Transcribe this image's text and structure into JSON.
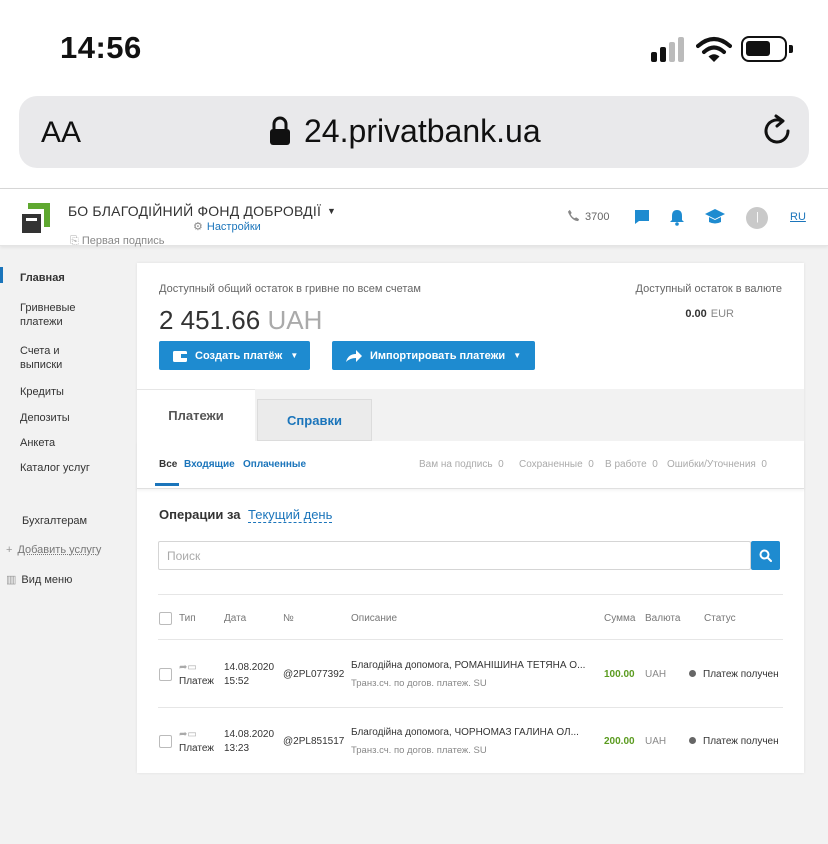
{
  "status_bar": {
    "time": "14:56"
  },
  "browser": {
    "text_size_label": "AA",
    "url": "24.privatbank.ua"
  },
  "header": {
    "org_name": "БО БЛАГОДІЙНИЙ ФОНД ДОБРОВДІЇ",
    "signature_label": "Первая подпись",
    "settings_label": "Настройки",
    "phone": "3700",
    "language": "RU",
    "avatar_letter": "|"
  },
  "sidebar": {
    "items": [
      {
        "label": "Главная",
        "active": true
      },
      {
        "label": "Гривневые платежи"
      },
      {
        "label": "Счета и выписки"
      },
      {
        "label": "Кредиты"
      },
      {
        "label": "Депозиты"
      },
      {
        "label": "Анкета"
      },
      {
        "label": "Каталог услуг"
      }
    ],
    "accountants_label": "Бухгалтерам",
    "add_service_label": "Добавить услугу",
    "view_menu_label": "Вид меню"
  },
  "balance": {
    "label": "Доступный общий остаток в гривне по всем счетам",
    "amount": "2 451.66",
    "currency": "UAH",
    "fx_label": "Доступный остаток в валюте",
    "fx_amount": "0.00",
    "fx_currency": "EUR"
  },
  "actions": {
    "create_payment": "Создать платёж",
    "import_payments": "Импортировать платежи"
  },
  "tabs": [
    {
      "label": "Платежи",
      "active": true
    },
    {
      "label": "Справки",
      "active": false
    }
  ],
  "filters": {
    "all": "Все",
    "incoming": "Входящие",
    "paid": "Оплаченные",
    "statuses": [
      {
        "label": "Вам на подпись",
        "count": "0"
      },
      {
        "label": "Сохраненные",
        "count": "0"
      },
      {
        "label": "В работе",
        "count": "0"
      },
      {
        "label": "Ошибки/Уточнения",
        "count": "0"
      }
    ]
  },
  "operations": {
    "label": "Операции за",
    "period": "Текущий день"
  },
  "search": {
    "placeholder": "Поиск"
  },
  "table": {
    "columns": [
      "Тип",
      "Дата",
      "№",
      "Описание",
      "Сумма",
      "Валюта",
      "Статус"
    ],
    "rows": [
      {
        "type": "Платеж",
        "date": "14.08.2020",
        "time": "15:52",
        "number": "@2PL077392",
        "description": "Благодійна допомога, РОМАНІШИНА ТЕТЯНА О...",
        "sub": "Транз.сч. по догов. платеж. SU",
        "amount": "100.00",
        "currency": "UAH",
        "status": "Платеж получен"
      },
      {
        "type": "Платеж",
        "date": "14.08.2020",
        "time": "13:23",
        "number": "@2PL851517",
        "description": "Благодійна допомога, ЧОРНОМАЗ ГАЛИНА ОЛ...",
        "sub": "Транз.сч. по догов. платеж. SU",
        "amount": "200.00",
        "currency": "UAH",
        "status": "Платеж получен"
      }
    ]
  },
  "colors": {
    "accent": "#1e8bd0",
    "link": "#1b75bb",
    "logo_green": "#5fa830",
    "amount_green": "#5a9b1f"
  },
  "icons": [
    "signal-icon",
    "wifi-icon",
    "battery-icon",
    "lock-icon",
    "reload-icon",
    "phone-icon",
    "chat-icon",
    "bell-icon",
    "graduation-cap-icon",
    "gear-icon",
    "wallet-icon",
    "share-arrow-icon",
    "filter-icon",
    "search-icon"
  ]
}
